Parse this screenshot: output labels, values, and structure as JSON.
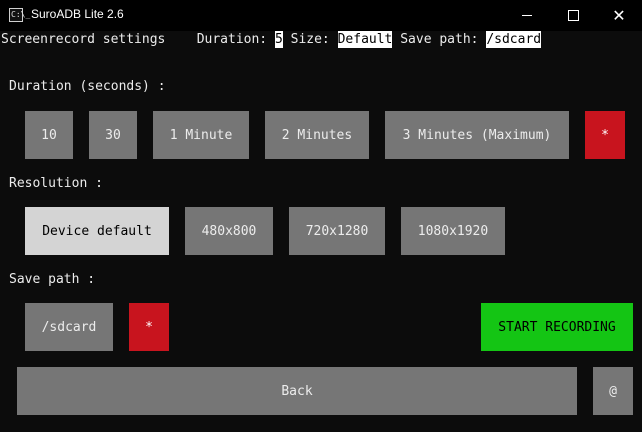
{
  "window": {
    "title": "SuroADB Lite 2.6",
    "icon_text": "C:\\_",
    "close_glyph": "✕"
  },
  "status": {
    "heading": "Screenrecord settings",
    "duration_label": "Duration:",
    "duration_value": "5",
    "size_label": "Size:",
    "size_value": "Default",
    "path_label": "Save path:",
    "path_value": "/sdcard"
  },
  "duration": {
    "label": "Duration (seconds) :",
    "options": [
      "10",
      "30",
      "1 Minute",
      "2 Minutes",
      "3 Minutes (Maximum)"
    ],
    "custom_label": "*"
  },
  "resolution": {
    "label": "Resolution :",
    "options": [
      "Device default",
      "480x800",
      "720x1280",
      "1080x1920"
    ],
    "selected": "Device default"
  },
  "save_path": {
    "label": "Save path :",
    "value": "/sdcard",
    "custom_label": "*"
  },
  "actions": {
    "start_label": "START RECORDING",
    "back_label": "Back",
    "at_label": "@"
  },
  "colors": {
    "background": "#0c0c0c",
    "button_gray": "#767676",
    "button_selected": "#d4d4d4",
    "accent_red": "#c8141e",
    "accent_green": "#14c514"
  }
}
